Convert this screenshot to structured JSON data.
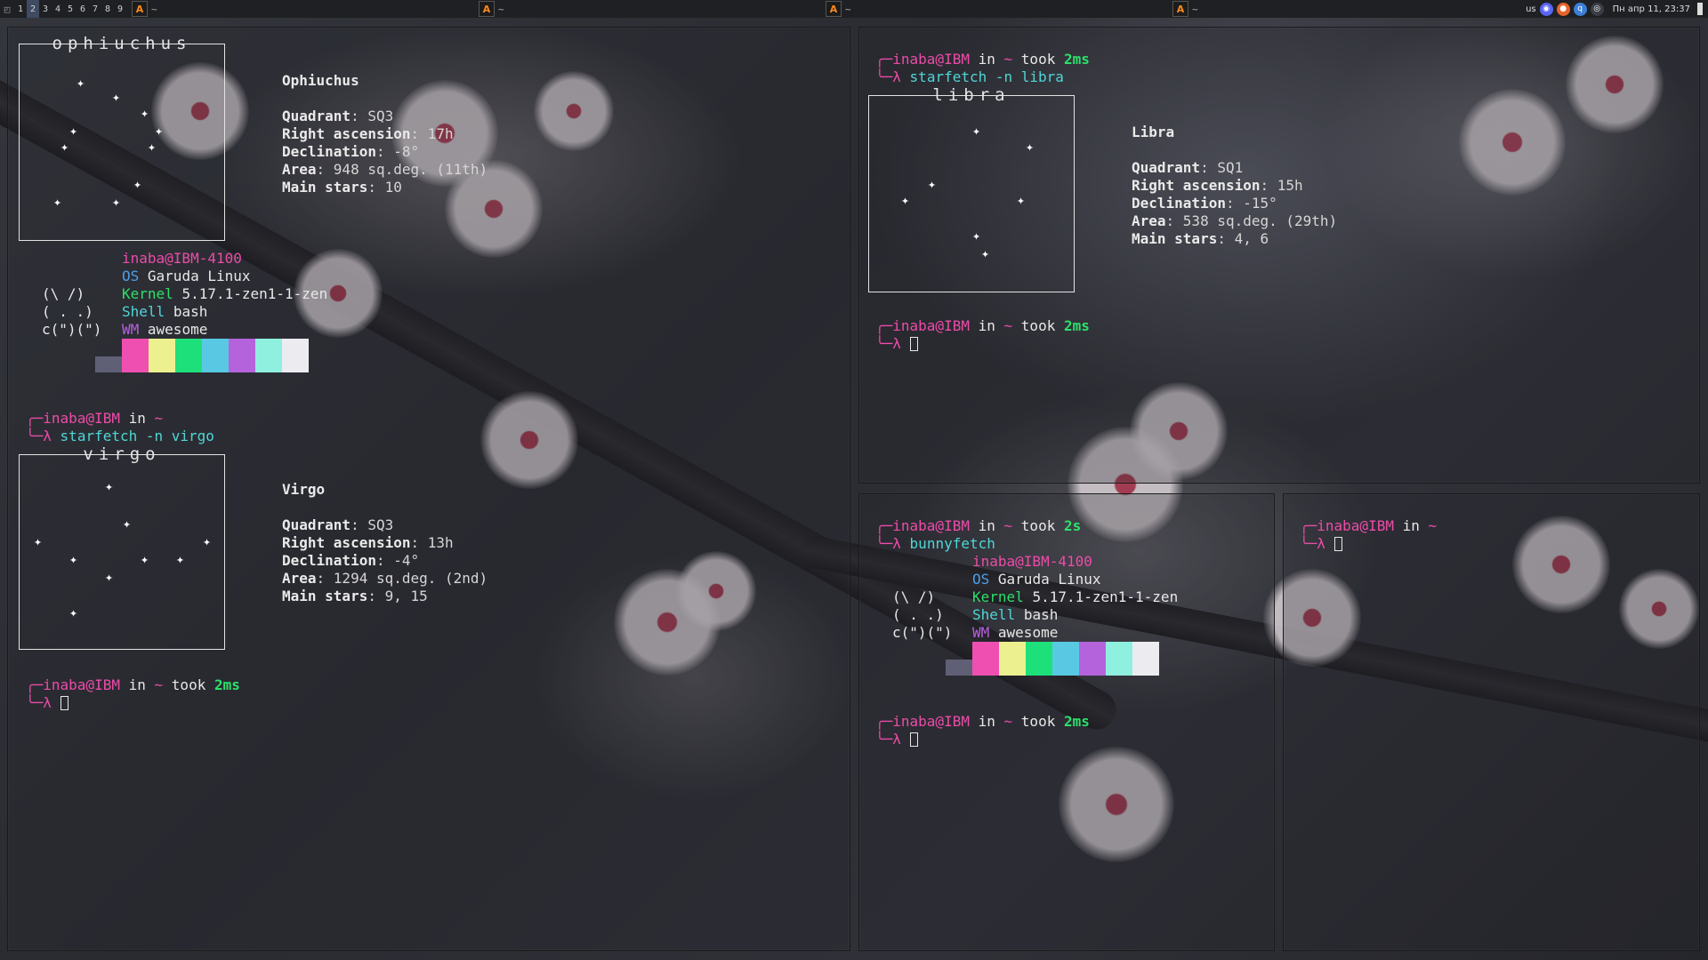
{
  "topbar": {
    "tags": [
      "1",
      "2",
      "3",
      "4",
      "5",
      "6",
      "7",
      "8",
      "9"
    ],
    "active_tag": "2",
    "app_icon_glyph": "A",
    "task_suffix": "~",
    "keyboard": "us",
    "clock": "Пн апр 11, 23:37",
    "tray_icons": [
      "discord-icon",
      "firefox-icon",
      "qbittorrent-icon",
      "steam-icon"
    ]
  },
  "user": "inaba@IBM",
  "in": "in",
  "home": "~",
  "took": "took",
  "lambda": "λ",
  "left": {
    "ophiuchus": {
      "box_title": "ophiuchus",
      "name": "Ophiuchus",
      "quadrant_label": "Quadrant",
      "quadrant": "SQ3",
      "ra_label": "Right ascension",
      "ra": "17h",
      "dec_label": "Declination",
      "dec": "-8°",
      "area_label": "Area",
      "area": "948 sq.deg. (11th)",
      "stars_label": "Main stars",
      "stars": "10"
    },
    "fetch": {
      "host": "inaba@IBM-4100",
      "os_label": "OS",
      "os": "Garuda Linux",
      "kernel_label": "Kernel",
      "kernel": "5.17.1-zen1-1-zen",
      "shell_label": "Shell",
      "shell": "bash",
      "wm_label": "WM",
      "wm": "awesome",
      "bunny1": "(\\ /)",
      "bunny2": "( . .)",
      "bunny3": "c(\")(\")"
    },
    "prompt1_cmd": "starfetch -n virgo",
    "virgo": {
      "box_title": "virgo",
      "name": "Virgo",
      "quadrant_label": "Quadrant",
      "quadrant": "SQ3",
      "ra_label": "Right ascension",
      "ra": "13h",
      "dec_label": "Declination",
      "dec": "-4°",
      "area_label": "Area",
      "area": "1294 sq.deg. (2nd)",
      "stars_label": "Main stars",
      "stars": "9, 15"
    },
    "prompt2_time": "2ms"
  },
  "right_top": {
    "prompt1_time": "2ms",
    "prompt1_cmd": "starfetch -n libra",
    "libra": {
      "box_title": "libra",
      "name": "Libra",
      "quadrant_label": "Quadrant",
      "quadrant": "SQ1",
      "ra_label": "Right ascension",
      "ra": "15h",
      "dec_label": "Declination",
      "dec": "-15°",
      "area_label": "Area",
      "area": "538 sq.deg. (29th)",
      "stars_label": "Main stars",
      "stars": "4, 6"
    },
    "prompt2_time": "2ms"
  },
  "bottom_mid": {
    "prompt1_time": "2s",
    "prompt1_cmd": "bunnyfetch",
    "prompt2_time": "2ms"
  },
  "swatch_colors": [
    "#5f6076",
    "#ef4fb1",
    "#ecf08f",
    "#1ee07a",
    "#59c9e3",
    "#b563dd",
    "#8ff0df",
    "#ececf0"
  ],
  "colors": {
    "accent_pink": "#ec4ca8",
    "accent_green": "#2ce06a"
  },
  "star_glyph": "✦"
}
